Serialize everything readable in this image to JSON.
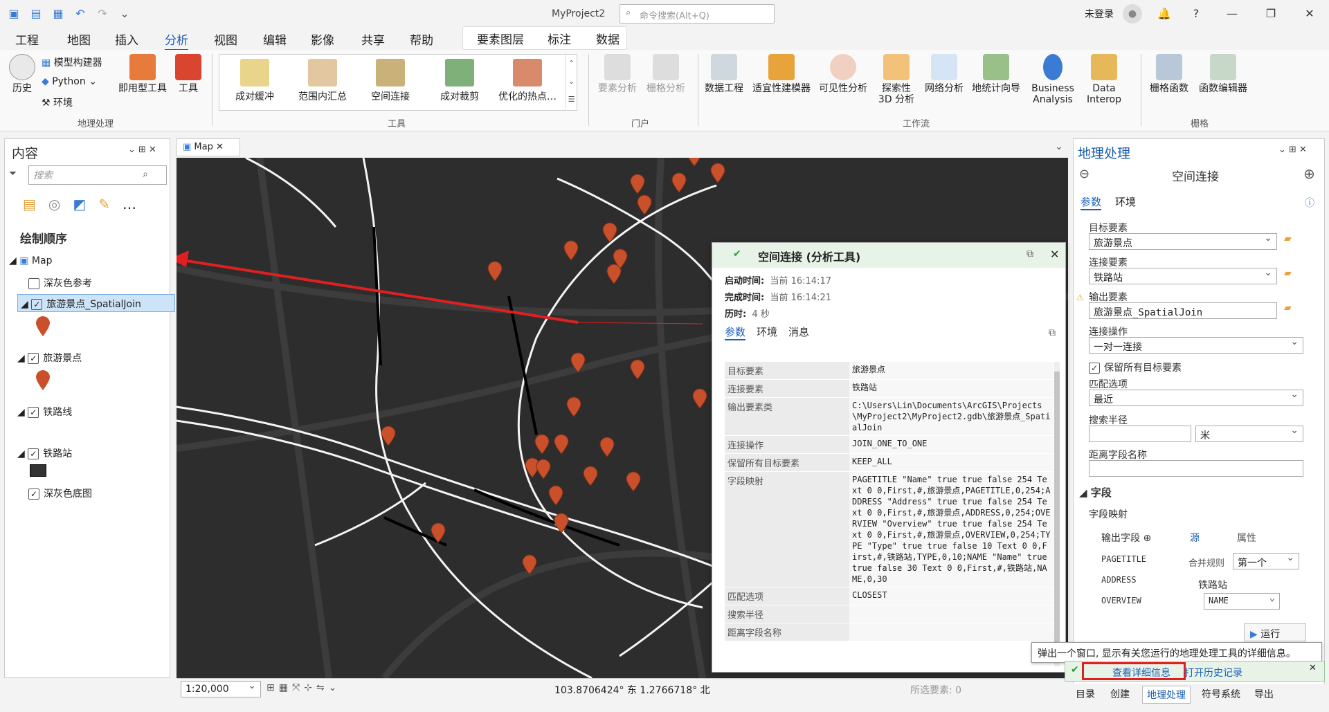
{
  "window": {
    "title": "MyProject2",
    "search_placeholder": "命令搜索(Alt+Q)",
    "user": "未登录"
  },
  "menu": [
    "工程",
    "地图",
    "插入",
    "分析",
    "视图",
    "编辑",
    "影像",
    "共享",
    "帮助"
  ],
  "context_tabs": [
    "要素图层",
    "标注",
    "数据"
  ],
  "ribbon": {
    "geoprocessing": {
      "history": "历史",
      "model_builder": "模型构建器",
      "python": "Python",
      "environment": "环境",
      "ready_tools": "即用型工具",
      "tools": "工具",
      "group": "地理处理"
    },
    "gallery": [
      "成对缓冲",
      "范围内汇总",
      "空间连接",
      "成对裁剪",
      "优化的热点…"
    ],
    "tools_group": "工具",
    "portal": {
      "feature_analysis": "要素分析",
      "raster_analysis": "栅格分析",
      "group": "门户"
    },
    "workflows": [
      "数据工程",
      "适宜性建模器",
      "可见性分析",
      "探索性 3D 分析",
      "网络分析",
      "地统计向导",
      "Business Analysis",
      "Data Interop"
    ],
    "workflows_group": "工作流",
    "raster": [
      "栅格函数",
      "函数编辑器"
    ],
    "raster_group": "栅格"
  },
  "contents": {
    "title": "内容",
    "search_placeholder": "搜索",
    "drawing_order": "绘制顺序",
    "map": "Map",
    "layers": [
      {
        "name": "深灰色参考",
        "checked": false
      },
      {
        "name": "旅游景点_SpatialJoin",
        "checked": true
      },
      {
        "name": "旅游景点",
        "checked": true
      },
      {
        "name": "铁路线",
        "checked": true
      },
      {
        "name": "铁路站",
        "checked": true
      },
      {
        "name": "深灰色底图",
        "checked": true
      }
    ]
  },
  "map_tab": "Map",
  "status": {
    "scale": "1:20,000",
    "coords": "103.8706424° 东 1.2766718° 北",
    "selected": "所选要素: 0"
  },
  "details": {
    "title": "空间连接 (分析工具)",
    "start_label": "启动时间:",
    "start": "当前 16:14:17",
    "end_label": "完成时间:",
    "end": "当前 16:14:21",
    "elapsed_label": "历时:",
    "elapsed": "4 秒",
    "tabs": [
      "参数",
      "环境",
      "消息"
    ],
    "rows": [
      {
        "k": "目标要素",
        "v": "旅游景点"
      },
      {
        "k": "连接要素",
        "v": "铁路站"
      },
      {
        "k": "输出要素类",
        "v": "C:\\Users\\Lin\\Documents\\ArcGIS\\Projects\\MyProject2\\MyProject2.gdb\\旅游景点_SpatialJoin"
      },
      {
        "k": "连接操作",
        "v": "JOIN_ONE_TO_ONE"
      },
      {
        "k": "保留所有目标要素",
        "v": "KEEP_ALL"
      },
      {
        "k": "字段映射",
        "v": "PAGETITLE \"Name\" true true false 254 Text 0 0,First,#,旅游景点,PAGETITLE,0,254;ADDRESS \"Address\" true true false 254 Text 0 0,First,#,旅游景点,ADDRESS,0,254;OVERVIEW \"Overview\" true true false 254 Text 0 0,First,#,旅游景点,OVERVIEW,0,254;TYPE \"Type\" true true false 10 Text 0 0,First,#,铁路站,TYPE,0,10;NAME \"Name\" true true false 30 Text 0 0,First,#,铁路站,NAME,0,30"
      },
      {
        "k": "匹配选项",
        "v": "CLOSEST"
      },
      {
        "k": "搜索半径",
        "v": ""
      },
      {
        "k": "距离字段名称",
        "v": ""
      }
    ]
  },
  "geoprocessing": {
    "title": "地理处理",
    "tool": "空间连接",
    "tabs": [
      "参数",
      "环境"
    ],
    "target_label": "目标要素",
    "target": "旅游景点",
    "join_label": "连接要素",
    "join": "铁路站",
    "output_label": "输出要素",
    "output": "旅游景点_SpatialJoin",
    "op_label": "连接操作",
    "op": "一对一连接",
    "keep_label": "保留所有目标要素",
    "match_label": "匹配选项",
    "match": "最近",
    "radius_label": "搜索半径",
    "radius_unit": "米",
    "distfield_label": "距离字段名称",
    "fields_section": "字段",
    "field_map_label": "字段映射",
    "out_fields_label": "输出字段",
    "source_tab": "源",
    "props_tab": "属性",
    "fields": [
      "PAGETITLE",
      "ADDRESS",
      "OVERVIEW"
    ],
    "merge_label": "合并规则",
    "merge": "第一个",
    "source_layer": "铁路站",
    "source_field": "NAME",
    "run": "运行"
  },
  "tooltip": "弹出一个窗口, 显示有关您运行的地理处理工具的详细信息。",
  "notify": {
    "view": "查看详细信息",
    "history": "打开历史记录"
  },
  "bottom_tabs": [
    "目录",
    "创建",
    "地理处理",
    "符号系统",
    "导出"
  ],
  "colors": {
    "accent": "#1a5fb4",
    "pin": "#c9502a",
    "map_bg": "#2d2d2d",
    "highlight": "#e02020"
  }
}
